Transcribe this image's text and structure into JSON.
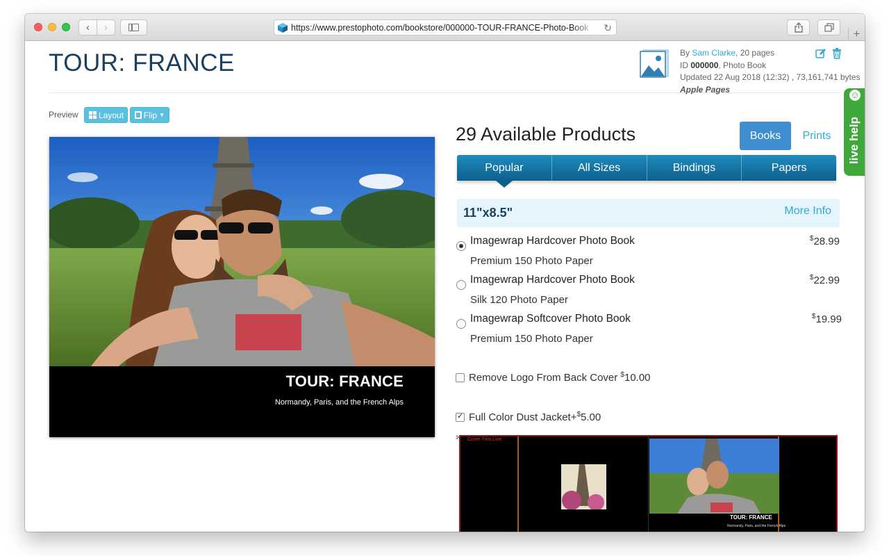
{
  "browser": {
    "url": "https://www.prestophoto.com/bookstore/000000-TOUR-FRANCE-Photo-Book"
  },
  "page": {
    "title": "TOUR: FRANCE"
  },
  "meta": {
    "by_label": "By",
    "author": "Sam Clarke",
    "pages": ", 20 pages",
    "id_label": "ID",
    "id": "000000",
    "type": ", Photo Book",
    "updated": "Updated 22 Aug 2018 (12:32) , 73,161,741 bytes",
    "source": "Apple Pages"
  },
  "livehelp": {
    "label": "live help"
  },
  "preview": {
    "label": "Preview",
    "layout_button": "Layout",
    "flip_button": "Flip"
  },
  "cover": {
    "title": "TOUR: FRANCE",
    "subtitle": "Normandy, Paris, and the French Alps"
  },
  "products": {
    "title": "29 Available Products",
    "toggle": [
      "Books",
      "Prints"
    ],
    "tabs": [
      "Popular",
      "All Sizes",
      "Bindings",
      "Papers"
    ],
    "size": "11\"x8.5\"",
    "more_info": "More Info",
    "items": [
      {
        "name": "Imagewrap Hardcover Photo Book",
        "paper": "Premium 150 Photo Paper",
        "currency": "$",
        "price": "28.99",
        "selected": true
      },
      {
        "name": "Imagewrap Hardcover Photo Book",
        "paper": "Silk 120 Photo Paper",
        "currency": "$",
        "price": "22.99",
        "selected": false
      },
      {
        "name": "Imagewrap Softcover Photo Book",
        "paper": "Premium 150 Photo Paper",
        "currency": "$",
        "price": "19.99",
        "selected": false
      }
    ]
  },
  "options": [
    {
      "label": "Remove Logo From Back Cover ",
      "currency": "$",
      "price": "10.00",
      "checked": false
    },
    {
      "label": "Full Color Dust Jacket+",
      "currency": "$",
      "price": "5.00",
      "checked": true
    }
  ],
  "jacket": {
    "trim_label": "Cover Trim Line",
    "title": "TOUR: FRANCE",
    "subtitle": "Normandy, Paris, and the French Alps"
  },
  "colors": {
    "title": "#1b3f5e",
    "link": "#2fa9d6",
    "accent": "#3f8ecf",
    "livehelp": "#3ea93a"
  }
}
